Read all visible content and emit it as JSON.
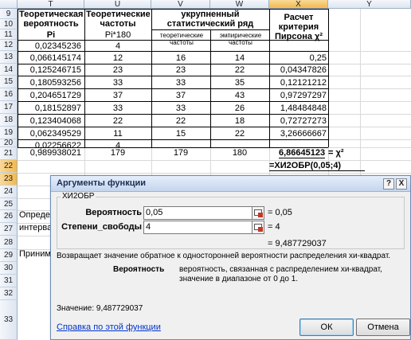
{
  "sheet": {
    "columns": [
      "T",
      "U",
      "V",
      "W",
      "X",
      "Y"
    ],
    "rows": [
      "9",
      "10",
      "11",
      "12",
      "13",
      "14",
      "15",
      "16",
      "17",
      "18",
      "19",
      "20",
      "21",
      "22",
      "23",
      "24",
      "25",
      "26",
      "27",
      "28",
      "29",
      "30",
      "31",
      "32",
      "33"
    ],
    "headers": {
      "t": "Теоретическая вероятность",
      "t2": "Pi",
      "u": "Теоретические частоты",
      "u2": "Pi*180",
      "vw": "укрупненный статистический ряд",
      "v_sub": "теоретические частоты",
      "w_sub": "эмпирические частоты",
      "x": "Расчет критерия Пирсона χ²"
    },
    "data": [
      {
        "t": "0,02345236",
        "u": "4",
        "v": "",
        "w": "",
        "x": ""
      },
      {
        "t": "0,066145174",
        "u": "12",
        "v": "16",
        "w": "14",
        "x": "0,25"
      },
      {
        "t": "0,125246715",
        "u": "23",
        "w_v": "",
        "v": "23",
        "w": "22",
        "x": "0,04347826"
      },
      {
        "t": "0,180593256",
        "u": "33",
        "v": "33",
        "w": "35",
        "x": "0,12121212"
      },
      {
        "t": "0,204651729",
        "u": "37",
        "v": "37",
        "w": "43",
        "x": "0,97297297"
      },
      {
        "t": "0,18152897",
        "u": "33",
        "v": "33",
        "w": "26",
        "x": "1,48484848"
      },
      {
        "t": "0,123404068",
        "u": "22",
        "v": "22",
        "w": "18",
        "x": "0,72727273"
      },
      {
        "t": "0,062349529",
        "u": "11",
        "v": "15",
        "w": "22",
        "x": "3,26666667"
      },
      {
        "t": "0,02256622",
        "u": "4",
        "v": "",
        "w": "",
        "x": ""
      }
    ],
    "totals": {
      "t": "0,989938021",
      "u": "179",
      "v": "179",
      "w": "180",
      "x": "6,86645123",
      "y": "= χ²"
    },
    "formula_cell": "=ХИ2ОБР(0,05;4)",
    "row27_text": "Определе",
    "row28_text": "интервало",
    "row30_text": "Принимае"
  },
  "dialog": {
    "title": "Аргументы функции",
    "help_btn": "?",
    "close_btn": "X",
    "function_name": "ХИ2ОБР",
    "arg1_label": "Вероятность",
    "arg1_value": "0,05",
    "arg1_result": "= 0,05",
    "arg2_label": "Степени_свободы",
    "arg2_value": "4",
    "arg2_result": "= 4",
    "result_line": "= 9,487729037",
    "description": "Возвращает значение обратное к односторонней вероятности распределения хи-квадрат.",
    "arg_help_label": "Вероятность",
    "arg_help_text": "вероятность, связанная с распределением хи-квадрат, значение в диапазоне от 0 до 1.",
    "value_line": "Значение:  9,487729037",
    "help_link": "Справка по этой функции",
    "ok_label": "ОК",
    "cancel_label": "Отмена"
  }
}
